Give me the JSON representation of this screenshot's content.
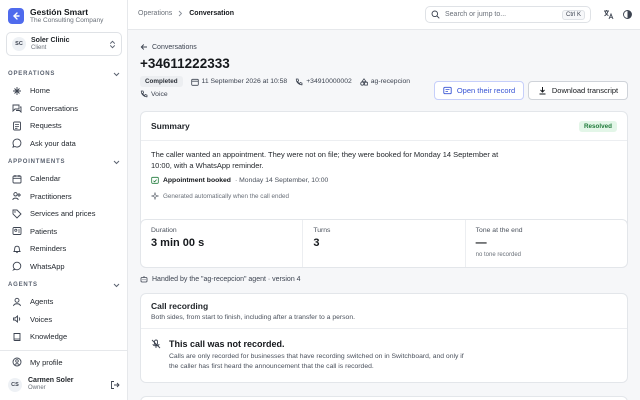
{
  "brand": {
    "name": "Gestión Smart",
    "subtitle": "The Consulting Company"
  },
  "client": {
    "initials": "SC",
    "name": "Soler Clinic",
    "role": "Client"
  },
  "sidebar": {
    "operations": {
      "title": "OPERATIONS",
      "items": [
        {
          "label": "Home",
          "icon": "home-icon"
        },
        {
          "label": "Conversations",
          "icon": "chat-icon"
        },
        {
          "label": "Requests",
          "icon": "requests-icon"
        },
        {
          "label": "Ask your data",
          "icon": "ask-icon"
        }
      ]
    },
    "appointments": {
      "title": "APPOINTMENTS",
      "items": [
        {
          "label": "Calendar",
          "icon": "calendar-icon"
        },
        {
          "label": "Practitioners",
          "icon": "practitioners-icon"
        },
        {
          "label": "Services and prices",
          "icon": "tag-icon"
        },
        {
          "label": "Patients",
          "icon": "patients-icon"
        },
        {
          "label": "Reminders",
          "icon": "bell-icon"
        },
        {
          "label": "WhatsApp",
          "icon": "whatsapp-icon"
        }
      ]
    },
    "agents": {
      "title": "AGENTS",
      "items": [
        {
          "label": "Agents",
          "icon": "agent-icon"
        },
        {
          "label": "Voices",
          "icon": "voice-icon"
        },
        {
          "label": "Knowledge",
          "icon": "book-icon"
        }
      ]
    },
    "profile_label": "My profile",
    "user": {
      "initials": "CS",
      "name": "Carmen Soler",
      "role": "Owner"
    }
  },
  "topbar": {
    "breadcrumb_parent": "Operations",
    "breadcrumb_current": "Conversation",
    "search_placeholder": "Search or jump to...",
    "search_shortcut": "Ctrl K"
  },
  "conversation": {
    "back_label": "Conversations",
    "title": "+34611222333",
    "status": "Completed",
    "date": "11 September 2026 at 10:58",
    "phone": "+34910000002",
    "agent": "ag-recepcion",
    "channel": "Voice",
    "open_record_label": "Open their record",
    "download_label": "Download transcript"
  },
  "summary": {
    "title": "Summary",
    "badge": "Resolved",
    "text": "The caller wanted an appointment. They were not on file; they were booked for Monday 14 September at 10:00, with a WhatsApp reminder.",
    "appointment_label": "Appointment booked",
    "appointment_detail": "· Monday 14 September, 10:00",
    "auto_note": "Generated automatically when the call ended"
  },
  "stats": {
    "duration_label": "Duration",
    "duration_value": "3 min 00 s",
    "turns_label": "Turns",
    "turns_value": "3",
    "tone_label": "Tone at the end",
    "tone_value": "—",
    "tone_note": "no tone recorded"
  },
  "handled_by": "Handled by the \"ag-recepcion\" agent · version 4",
  "recording": {
    "title": "Call recording",
    "subtitle": "Both sides, from start to finish, including after a transfer to a person.",
    "not_recorded_title": "This call was not recorded.",
    "not_recorded_text": "Calls are only recorded for businesses that have recording switched on in Switchboard, and only if the caller has first heard the announcement that the call is recorded."
  },
  "colors": {
    "accent": "#4f6bed",
    "resolved": "#1f7a3a",
    "link": "#3552d4"
  }
}
